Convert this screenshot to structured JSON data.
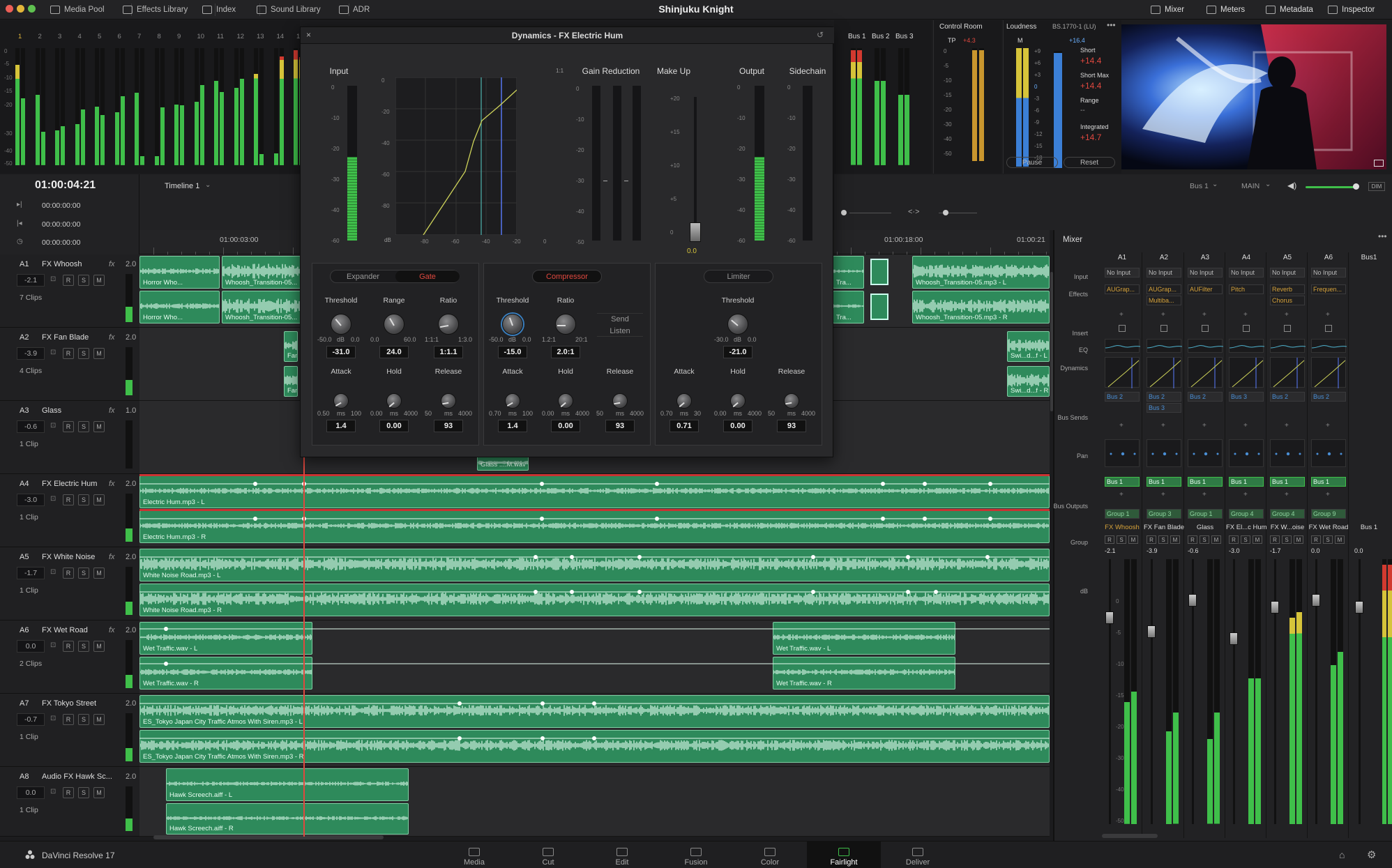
{
  "window": {
    "title": "Shinjuku Knight"
  },
  "toolbar": {
    "left": [
      {
        "label": "Media Pool",
        "icon": "media-pool-icon"
      },
      {
        "label": "Effects Library",
        "icon": "effects-icon"
      },
      {
        "label": "Index",
        "icon": "index-icon"
      },
      {
        "label": "Sound Library",
        "icon": "sound-library-icon"
      },
      {
        "label": "ADR",
        "icon": "adr-icon"
      }
    ],
    "right": [
      {
        "label": "Mixer",
        "icon": "mixer-icon"
      },
      {
        "label": "Meters",
        "icon": "meters-icon"
      },
      {
        "label": "Metadata",
        "icon": "metadata-icon"
      },
      {
        "label": "Inspector",
        "icon": "inspector-icon"
      }
    ]
  },
  "top_meters": {
    "channel_numbers": [
      "1",
      "2",
      "3",
      "4",
      "5",
      "6",
      "7",
      "8",
      "9",
      "10",
      "11",
      "12",
      "13",
      "14",
      "15"
    ],
    "scale": [
      "0",
      "-5",
      "-10",
      "-15",
      "-20",
      "-30",
      "-40",
      "-50"
    ],
    "bus_labels": [
      "Bus 1",
      "Bus 2",
      "Bus 3"
    ],
    "control_room": {
      "title": "Control Room",
      "tp_label": "TP",
      "tp_value": "+4.3",
      "scale": [
        "0",
        "-5",
        "-10",
        "-15",
        "-20",
        "-30",
        "-40",
        "-50"
      ]
    },
    "loudness": {
      "title": "Loudness",
      "standard": "BS.1770-1 (LU)",
      "m_label": "M",
      "m_value": "+16.4",
      "scale": [
        "+9",
        "+6",
        "+3",
        "0",
        "-3",
        "-6",
        "-9",
        "-12",
        "-15",
        "-18"
      ],
      "short_label": "Short",
      "short_value": "+14.4",
      "short_max_label": "Short Max",
      "short_max_value": "+14.4",
      "range_label": "Range",
      "range_value": "--",
      "integrated_label": "Integrated",
      "integrated_value": "+14.7",
      "pause": "Pause",
      "reset": "Reset"
    }
  },
  "transport": {
    "timecode": "01:00:04:21",
    "timeline_name": "Timeline 1",
    "in_tc": "00:00:00:00",
    "out_tc": "00:00:00:00",
    "dur_tc": "00:00:00:00",
    "ruler": [
      "01:00:03:00",
      "01:00:18:00",
      "01:00:21"
    ],
    "bus_select": "Bus 1",
    "main_select": "MAIN",
    "dim_label": "DIM"
  },
  "tracks": [
    {
      "id": "A1",
      "name": "FX Whoosh",
      "fx": "fx",
      "lvl": "2.0",
      "vol": "-2.1",
      "clips": "7 Clips"
    },
    {
      "id": "A2",
      "name": "FX Fan Blade",
      "fx": "fx",
      "lvl": "2.0",
      "vol": "-3.9",
      "clips": "4 Clips"
    },
    {
      "id": "A3",
      "name": "Glass",
      "fx": "fx",
      "lvl": "1.0",
      "vol": "-0.6",
      "clips": "1 Clip"
    },
    {
      "id": "A4",
      "name": "FX Electric Hum",
      "fx": "fx",
      "lvl": "2.0",
      "vol": "-3.0",
      "clips": "1 Clip"
    },
    {
      "id": "A5",
      "name": "FX White Noise",
      "fx": "fx",
      "lvl": "2.0",
      "vol": "-1.7",
      "clips": "1 Clip"
    },
    {
      "id": "A6",
      "name": "FX Wet Road",
      "fx": "fx",
      "lvl": "2.0",
      "vol": "0.0",
      "clips": "2 Clips"
    },
    {
      "id": "A7",
      "name": "FX Tokyo Street",
      "fx": "",
      "lvl": "2.0",
      "vol": "-0.7",
      "clips": "1 Clip"
    },
    {
      "id": "A8",
      "name": "Audio FX Hawk Sc...",
      "fx": "",
      "lvl": "2.0",
      "vol": "0.0",
      "clips": "1 Clip"
    }
  ],
  "track_buttons": [
    "R",
    "S",
    "M"
  ],
  "clip_names": {
    "a1_l1": "Horror Who...",
    "a1_l2": "Whoosh_Transition-05...",
    "a1_r1": "Horror Who...",
    "a1_r2": "Whoosh_Transition-05...",
    "a1_tra_l": "Tra...",
    "a1_tra_r": "Tra...",
    "a1_end_l": "Whoosh_Transition-05.mp3 - L",
    "a1_end_r": "Whoosh_Transition-05.mp3 - R",
    "a2_fan1": "Fan",
    "a2_fan2": "Fan",
    "a2_sw1": "Swi...d...f - L",
    "a2_sw2": "Swi...d...f - R",
    "glass": "Glass ....M.wav",
    "a4_l": "Electric Hum.mp3 - L",
    "a4_r": "Electric Hum.mp3 - R",
    "a5_l": "White Noise Road.mp3 - L",
    "a5_r": "White Noise Road.mp3 - R",
    "a6_l1": "Wet Traffic.wav - L",
    "a6_r1": "Wet Traffic.wav - R",
    "a6_l2": "Wet Traffic.wav - L",
    "a6_r2": "Wet Traffic.wav - R",
    "a7_l": "ES_Tokyo Japan City Traffic Atmos With Siren.mp3 - L",
    "a7_r": "ES_Tokyo Japan City Traffic Atmos With Siren.mp3 - R",
    "a8_l": "Hawk Screech.aiff - L",
    "a8_r": "Hawk Screech.aiff - R"
  },
  "dynamics": {
    "title": "Dynamics - FX Electric Hum",
    "input_label": "Input",
    "gain_reduction_label": "Gain Reduction",
    "makeup_label": "Make Up",
    "output_label": "Output",
    "sidechain_label": "Sidechain",
    "ratio_mark": "1:1",
    "db_unit": "dB",
    "input_scale": [
      "0",
      "-10",
      "-20",
      "-30",
      "-40",
      "-60"
    ],
    "graph_y": [
      "0",
      "-20",
      "-40",
      "-60",
      "-80"
    ],
    "graph_x": [
      "-80",
      "-60",
      "-40",
      "-20",
      "0"
    ],
    "gr_scale": [
      "0",
      "-10",
      "-20",
      "-30",
      "-40",
      "-50"
    ],
    "makeup_scale": [
      "+20",
      "+15",
      "+10",
      "+5",
      "0"
    ],
    "makeup_value": "0.0",
    "output_scale": [
      "0",
      "-10",
      "-20",
      "-30",
      "-40",
      "-60"
    ],
    "expander_tab": "Expander",
    "gate_tab": "Gate",
    "compressor_tab": "Compressor",
    "limiter_tab": "Limiter",
    "send": "Send",
    "listen": "Listen",
    "gate": {
      "threshold": {
        "label": "Threshold",
        "min": "-50.0",
        "unit": "dB",
        "max": "0.0",
        "value": "-31.0"
      },
      "range": {
        "label": "Range",
        "min": "0.0",
        "max": "60.0",
        "value": "24.0"
      },
      "ratio": {
        "label": "Ratio",
        "min": "1:1:1",
        "max": "1:3.0",
        "value": "1:1.1"
      },
      "attack": {
        "label": "Attack",
        "min": "0.50",
        "unit": "ms",
        "max": "100",
        "value": "1.4"
      },
      "hold": {
        "label": "Hold",
        "min": "0.00",
        "unit": "ms",
        "max": "4000",
        "value": "0.00"
      },
      "release": {
        "label": "Release",
        "min": "50",
        "unit": "ms",
        "max": "4000",
        "value": "93"
      }
    },
    "compressor": {
      "threshold": {
        "label": "Threshold",
        "min": "-50.0",
        "unit": "dB",
        "max": "0.0",
        "value": "-15.0"
      },
      "ratio": {
        "label": "Ratio",
        "min": "1.2:1",
        "max": "20:1",
        "value": "2.0:1"
      },
      "attack": {
        "label": "Attack",
        "min": "0.70",
        "unit": "ms",
        "max": "100",
        "value": "1.4"
      },
      "hold": {
        "label": "Hold",
        "min": "0.00",
        "unit": "ms",
        "max": "4000",
        "value": "0.00"
      },
      "release": {
        "label": "Release",
        "min": "50",
        "unit": "ms",
        "max": "4000",
        "value": "93"
      }
    },
    "limiter": {
      "threshold": {
        "label": "Threshold",
        "min": "-30.0",
        "unit": "dB",
        "max": "0.0",
        "value": "-21.0"
      },
      "attack": {
        "label": "Attack",
        "min": "0.70",
        "unit": "ms",
        "max": "30",
        "value": "0.71"
      },
      "hold": {
        "label": "Hold",
        "min": "0.00",
        "unit": "ms",
        "max": "4000",
        "value": "0.00"
      },
      "release": {
        "label": "Release",
        "min": "50",
        "unit": "ms",
        "max": "4000",
        "value": "93"
      }
    }
  },
  "mixer": {
    "title": "Mixer",
    "row_labels": {
      "input": "Input",
      "effects": "Effects",
      "insert": "Insert",
      "eq": "EQ",
      "dynamics": "Dynamics",
      "bus_sends": "Bus Sends",
      "pan": "Pan",
      "bus_outputs": "Bus Outputs",
      "group": "Group",
      "db": "dB"
    },
    "strips": [
      {
        "ch": "A1",
        "input": "No Input",
        "fx": [
          "AUGrap..."
        ],
        "send": [
          "Bus 2"
        ],
        "out": "Bus 1",
        "group": "Group 1",
        "name": "FX Whoosh",
        "db": "-2.1"
      },
      {
        "ch": "A2",
        "input": "No Input",
        "fx": [
          "AUGrap...",
          "Multiba..."
        ],
        "send": [
          "Bus 2",
          "Bus 3"
        ],
        "out": "Bus 1",
        "group": "Group 3",
        "name": "FX Fan Blade",
        "db": "-3.9"
      },
      {
        "ch": "A3",
        "input": "No Input",
        "fx": [
          "AUFilter"
        ],
        "send": [
          "Bus 2"
        ],
        "out": "Bus 1",
        "group": "Group 1",
        "name": "Glass",
        "db": "-0.6"
      },
      {
        "ch": "A4",
        "input": "No Input",
        "fx": [
          "Pitch"
        ],
        "send": [
          "Bus 3"
        ],
        "out": "Bus 1",
        "group": "Group 4",
        "name": "FX El...c Hum",
        "db": "-3.0"
      },
      {
        "ch": "A5",
        "input": "No Input",
        "fx": [
          "Reverb",
          "Chorus"
        ],
        "send": [
          "Bus 2"
        ],
        "out": "Bus 1",
        "group": "Group 4",
        "name": "FX W...oise",
        "db": "-1.7"
      },
      {
        "ch": "A6",
        "input": "No Input",
        "fx": [
          "Frequen..."
        ],
        "send": [
          "Bus 2"
        ],
        "out": "Bus 1",
        "group": "Group 9",
        "name": "FX Wet Road",
        "db": "0.0"
      }
    ],
    "bus_strip": {
      "ch": "Bus1",
      "name": "Bus 1",
      "db": "0.0"
    },
    "strip_buttons": [
      "R",
      "S",
      "M"
    ],
    "fader_scale": [
      "0",
      "-5",
      "-10",
      "-15",
      "-20",
      "-30",
      "-40",
      "-50"
    ]
  },
  "bottom": {
    "app_name": "DaVinci Resolve 17",
    "pages": [
      {
        "label": "Media",
        "icon": "media-page-icon"
      },
      {
        "label": "Cut",
        "icon": "cut-page-icon"
      },
      {
        "label": "Edit",
        "icon": "edit-page-icon"
      },
      {
        "label": "Fusion",
        "icon": "fusion-page-icon"
      },
      {
        "label": "Color",
        "icon": "color-page-icon"
      },
      {
        "label": "Fairlight",
        "icon": "fairlight-page-icon"
      },
      {
        "label": "Deliver",
        "icon": "deliver-page-icon"
      }
    ],
    "active_page": "Fairlight"
  },
  "colors": {
    "accent": "#e0483f",
    "clip_green": "#2e8a5b",
    "meter_green": "#3fbf4a",
    "meter_yellow": "#d6c43a",
    "meter_red": "#d23a30",
    "loudness_blue": "#3b7fd6",
    "tp_orange": "#c9962e"
  }
}
